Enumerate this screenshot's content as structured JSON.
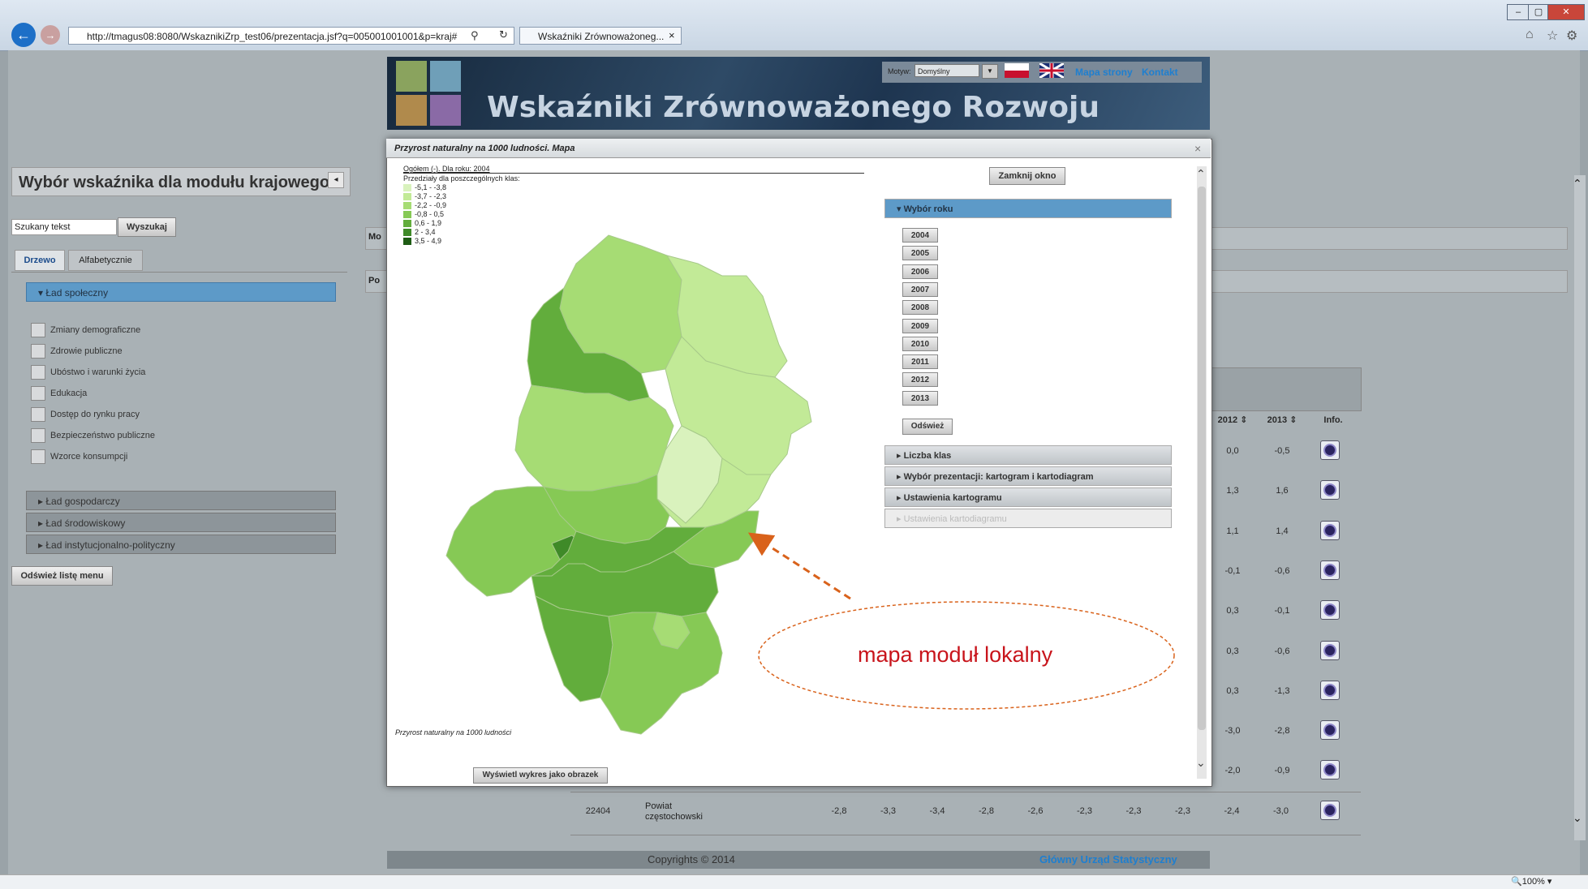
{
  "browser": {
    "url": "http://tmagus08:8080/WskaznikiZrp_test06/prezentacja.jsf?q=005001001001&p=kraj#",
    "tab_title": "Wskaźniki Zrównoważoneg...",
    "zoom": "100%"
  },
  "header": {
    "title": "Wskaźniki Zrównoważonego Rozwoju",
    "motyw_label": "Motyw:",
    "motyw_value": "Domyślny",
    "site_map": "Mapa strony",
    "contact": "Kontakt"
  },
  "left_panel": {
    "title": "Wybór wskaźnika dla modułu krajowego",
    "search_placeholder": "Szukany tekst",
    "search_button": "Wyszukaj",
    "tabs": [
      "Drzewo",
      "Alfabetycznie"
    ],
    "open_section": "Ład społeczny",
    "items": [
      "Zmiany demograficzne",
      "Zdrowie publiczne",
      "Ubóstwo i warunki życia",
      "Edukacja",
      "Dostęp do rynku pracy",
      "Bezpieczeństwo publiczne",
      "Wzorce konsumpcji"
    ],
    "sections": [
      "Ład gospodarczy",
      "Ład środowiskowy",
      "Ład instytucjonalno-polityczny"
    ],
    "refresh_button": "Odśwież listę menu",
    "stub_tabs": [
      "Mo",
      "Po"
    ]
  },
  "bg_table": {
    "headers": [
      "2012",
      "2013",
      "Info."
    ],
    "rows": [
      {
        "v2012": "0,0",
        "v2013": "-0,5"
      },
      {
        "v2012": "1,3",
        "v2013": "1,6"
      },
      {
        "v2012": "1,1",
        "v2013": "1,4"
      },
      {
        "v2012": "-0,1",
        "v2013": "-0,6"
      },
      {
        "v2012": "0,3",
        "v2013": "-0,1"
      },
      {
        "v2012": "0,3",
        "v2013": "-0,6"
      },
      {
        "v2012": "0,3",
        "v2013": "-1,3"
      },
      {
        "v2012": "-3,0",
        "v2013": "-2,8"
      },
      {
        "v2012": "-2,0",
        "v2013": "-0,9"
      }
    ],
    "last_row": {
      "code": "22404",
      "name": "Powiat częstochowski",
      "values": [
        "-2,8",
        "-3,3",
        "-3,4",
        "-2,8",
        "-2,6",
        "-2,3",
        "-2,3",
        "-2,3",
        "-2,4",
        "-3,0"
      ]
    }
  },
  "modal": {
    "title": "Przyrost naturalny na 1000 ludności. Mapa",
    "close_symbol": "×",
    "close_button": "Zamknij okno",
    "map_header": "Ogółem (-). Dla roku: 2004",
    "legend_title": "Przedziały dla poszczególnych klas:",
    "legend": [
      {
        "label": "-5,1 - -3,8",
        "color": "#d9f2bd"
      },
      {
        "label": "-3,7 - -2,3",
        "color": "#c2ea97"
      },
      {
        "label": "-2,2 - -0,9",
        "color": "#a6dc74"
      },
      {
        "label": "-0,8 - 0,5",
        "color": "#86c955"
      },
      {
        "label": "0,6 - 1,9",
        "color": "#62ad3c"
      },
      {
        "label": "2 - 3,4",
        "color": "#3f8a28"
      },
      {
        "label": "3,5 - 4,9",
        "color": "#1e5c14"
      }
    ],
    "map_caption": "Przyrost naturalny na 1000 ludności",
    "image_button": "Wyświetl wykres jako obrazek",
    "year_section": "Wybór roku",
    "years": [
      "2004",
      "2005",
      "2006",
      "2007",
      "2008",
      "2009",
      "2010",
      "2011",
      "2012",
      "2013"
    ],
    "refresh_button": "Odśwież",
    "panels": [
      "Liczba klas",
      "Wybór prezentacji: kartogram i kartodiagram",
      "Ustawienia kartogramu",
      "Ustawienia kartodiagramu"
    ]
  },
  "annotation": "mapa moduł lokalny",
  "footer": {
    "copyright": "Copyrights © 2014",
    "link": "Główny Urząd Statystyczny"
  }
}
